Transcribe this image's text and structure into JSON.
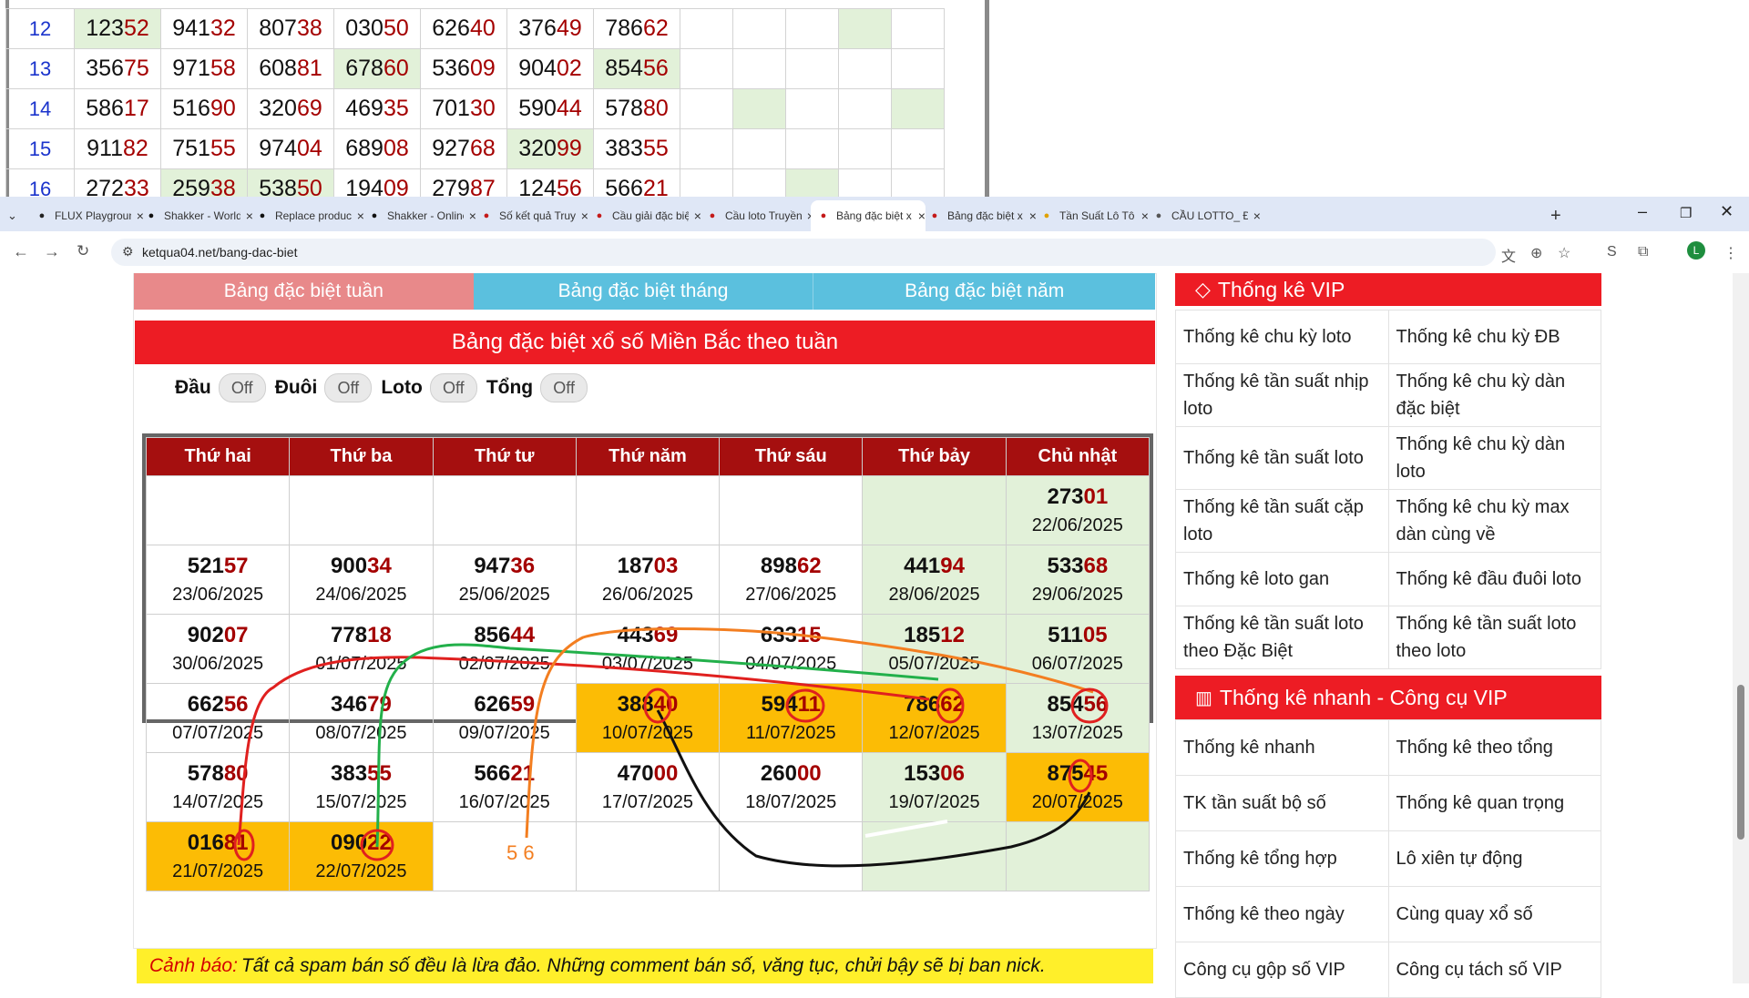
{
  "overlay_table": {
    "rows": [
      {
        "n": "12",
        "cells": [
          [
            "123",
            "52"
          ],
          [
            "941",
            "32"
          ],
          [
            "807",
            "38"
          ],
          [
            "030",
            "50"
          ],
          [
            "626",
            "40"
          ],
          [
            "376",
            "49"
          ],
          [
            "786",
            "62"
          ]
        ],
        "greens": [
          0,
          10
        ]
      },
      {
        "n": "13",
        "cells": [
          [
            "356",
            "75"
          ],
          [
            "971",
            "58"
          ],
          [
            "608",
            "81"
          ],
          [
            "678",
            "60"
          ],
          [
            "536",
            "09"
          ],
          [
            "904",
            "02"
          ],
          [
            "854",
            "56"
          ]
        ],
        "greens": [
          3,
          6
        ]
      },
      {
        "n": "14",
        "cells": [
          [
            "586",
            "17"
          ],
          [
            "516",
            "90"
          ],
          [
            "320",
            "69"
          ],
          [
            "469",
            "35"
          ],
          [
            "701",
            "30"
          ],
          [
            "590",
            "44"
          ],
          [
            "578",
            "80"
          ]
        ],
        "greens": [
          8,
          11
        ]
      },
      {
        "n": "15",
        "cells": [
          [
            "911",
            "82"
          ],
          [
            "751",
            "55"
          ],
          [
            "974",
            "04"
          ],
          [
            "689",
            "08"
          ],
          [
            "927",
            "68"
          ],
          [
            "320",
            "99"
          ],
          [
            "383",
            "55"
          ]
        ],
        "greens": [
          5
        ]
      },
      {
        "n": "16",
        "cells": [
          [
            "272",
            "33"
          ],
          [
            "259",
            "38"
          ],
          [
            "538",
            "50"
          ],
          [
            "194",
            "09"
          ],
          [
            "279",
            "87"
          ],
          [
            "124",
            "56"
          ],
          [
            "566",
            "21"
          ]
        ],
        "greens": [
          1,
          2,
          9
        ]
      }
    ]
  },
  "browser": {
    "tabs": [
      {
        "title": "FLUX Playground",
        "icon": "flux-icon",
        "color": "#222"
      },
      {
        "title": "Shakker - World",
        "icon": "shakker-icon",
        "color": "#111"
      },
      {
        "title": "Replace product",
        "icon": "replace-icon",
        "color": "#111"
      },
      {
        "title": "Shakker - Online",
        "icon": "shakker-icon",
        "color": "#111"
      },
      {
        "title": "Số kết quả Truyền",
        "icon": "ketqua-icon",
        "color": "#c41a1a"
      },
      {
        "title": "Cầu giải đặc biệt",
        "icon": "ketqua-icon",
        "color": "#c41a1a"
      },
      {
        "title": "Cầu loto Truyền",
        "icon": "ketqua-icon",
        "color": "#c41a1a"
      },
      {
        "title": "Bảng đặc biệt x",
        "icon": "ketqua-icon",
        "color": "#c41a1a"
      },
      {
        "title": "Bảng đặc biệt x",
        "icon": "ketqua-icon",
        "color": "#c41a1a"
      },
      {
        "title": "Tần Suất Lô Tô",
        "icon": "smile-icon",
        "color": "#e0a100"
      },
      {
        "title": "CẦU LOTTO_ Đ",
        "icon": "globe-icon",
        "color": "#555"
      }
    ],
    "active_tab": 7,
    "new_tab": "+",
    "url": "ketqua04.net/bang-dac-biet",
    "profile": "L"
  },
  "page": {
    "buttons": [
      "Bảng đặc biệt tuần",
      "Bảng đặc biệt tháng",
      "Bảng đặc biệt năm"
    ],
    "heading": "Bảng đặc biệt xổ số Miền Bắc theo tuần",
    "toggles": [
      {
        "label": "Đầu",
        "state": "Off"
      },
      {
        "label": "Đuôi",
        "state": "Off"
      },
      {
        "label": "Loto",
        "state": "Off"
      },
      {
        "label": "Tổng",
        "state": "Off"
      }
    ],
    "weekdays": [
      "Thứ hai",
      "Thứ ba",
      "Thứ tư",
      "Thứ năm",
      "Thứ sáu",
      "Thứ bảy",
      "Chủ nhật"
    ],
    "weeks": [
      [
        null,
        null,
        null,
        null,
        null,
        {
          "bg": "g"
        },
        {
          "a": "273",
          "b": "01",
          "date": "22/06/2025",
          "bg": "g"
        }
      ],
      [
        {
          "a": "521",
          "b": "57",
          "date": "23/06/2025"
        },
        {
          "a": "900",
          "b": "34",
          "date": "24/06/2025"
        },
        {
          "a": "947",
          "b": "36",
          "date": "25/06/2025"
        },
        {
          "a": "187",
          "b": "03",
          "date": "26/06/2025"
        },
        {
          "a": "898",
          "b": "62",
          "date": "27/06/2025"
        },
        {
          "a": "441",
          "b": "94",
          "date": "28/06/2025",
          "bg": "g"
        },
        {
          "a": "533",
          "b": "68",
          "date": "29/06/2025",
          "bg": "g"
        }
      ],
      [
        {
          "a": "902",
          "b": "07",
          "date": "30/06/2025"
        },
        {
          "a": "778",
          "b": "18",
          "date": "01/07/2025"
        },
        {
          "a": "856",
          "b": "44",
          "date": "02/07/2025"
        },
        {
          "a": "443",
          "b": "69",
          "date": "03/07/2025"
        },
        {
          "a": "633",
          "b": "15",
          "date": "04/07/2025"
        },
        {
          "a": "185",
          "b": "12",
          "date": "05/07/2025",
          "bg": "g"
        },
        {
          "a": "511",
          "b": "05",
          "date": "06/07/2025",
          "bg": "g"
        }
      ],
      [
        {
          "a": "662",
          "b": "56",
          "date": "07/07/2025"
        },
        {
          "a": "346",
          "b": "79",
          "date": "08/07/2025"
        },
        {
          "a": "626",
          "b": "59",
          "date": "09/07/2025"
        },
        {
          "a": "388",
          "b": "40",
          "date": "10/07/2025",
          "bg": "y"
        },
        {
          "a": "594",
          "b": "11",
          "date": "11/07/2025",
          "bg": "y"
        },
        {
          "a": "786",
          "b": "62",
          "date": "12/07/2025",
          "bg": "y"
        },
        {
          "a": "854",
          "b": "56",
          "date": "13/07/2025",
          "bg": "g"
        }
      ],
      [
        {
          "a": "578",
          "b": "80",
          "date": "14/07/2025"
        },
        {
          "a": "383",
          "b": "55",
          "date": "15/07/2025"
        },
        {
          "a": "566",
          "b": "21",
          "date": "16/07/2025"
        },
        {
          "a": "470",
          "b": "00",
          "date": "17/07/2025"
        },
        {
          "a": "260",
          "b": "00",
          "date": "18/07/2025"
        },
        {
          "a": "153",
          "b": "06",
          "date": "19/07/2025",
          "bg": "g"
        },
        {
          "a": "875",
          "b": "45",
          "date": "20/07/2025",
          "bg": "y"
        }
      ],
      [
        {
          "a": "016",
          "b": "81",
          "date": "21/07/2025",
          "bg": "y"
        },
        {
          "a": "090",
          "b": "22",
          "date": "22/07/2025",
          "bg": "y"
        },
        null,
        null,
        null,
        {
          "bg": "g"
        },
        {
          "bg": "g"
        }
      ]
    ],
    "annotation_text": "5 6",
    "warning_label": "Cảnh báo:",
    "warning_text": "Tất cả spam bán số đều là lừa đảo. Những comment bán số, văng tục, chửi bậy sẽ bị ban nick."
  },
  "sidebar": {
    "vip_title": "Thống kê VIP",
    "vip_items": [
      [
        "Thống kê chu kỳ loto",
        "Thống kê chu kỳ ĐB"
      ],
      [
        "Thống kê tần suất nhịp loto",
        "Thống kê chu kỳ dàn đặc biệt"
      ],
      [
        "Thống kê tần suất loto",
        "Thống kê chu kỳ dàn loto"
      ],
      [
        "Thống kê tần suất cặp loto",
        "Thống kê chu kỳ max dàn cùng về"
      ],
      [
        "Thống kê loto gan",
        "Thống kê đầu đuôi loto"
      ],
      [
        "Thống kê tần suất loto theo Đặc Biệt",
        "Thống kê tần suất loto theo loto"
      ]
    ],
    "quick_title": "Thống kê nhanh - Công cụ VIP",
    "quick_items": [
      [
        "Thống kê nhanh",
        "Thống kê theo tổng"
      ],
      [
        "TK tần suất bộ số",
        "Thống kê quan trọng"
      ],
      [
        "Thống kê tổng hợp",
        "Lô xiên tự động"
      ],
      [
        "Thống kê theo ngày",
        "Cùng quay xổ số"
      ],
      [
        "Công cụ gộp số VIP",
        "Công cụ tách số VIP"
      ]
    ]
  }
}
